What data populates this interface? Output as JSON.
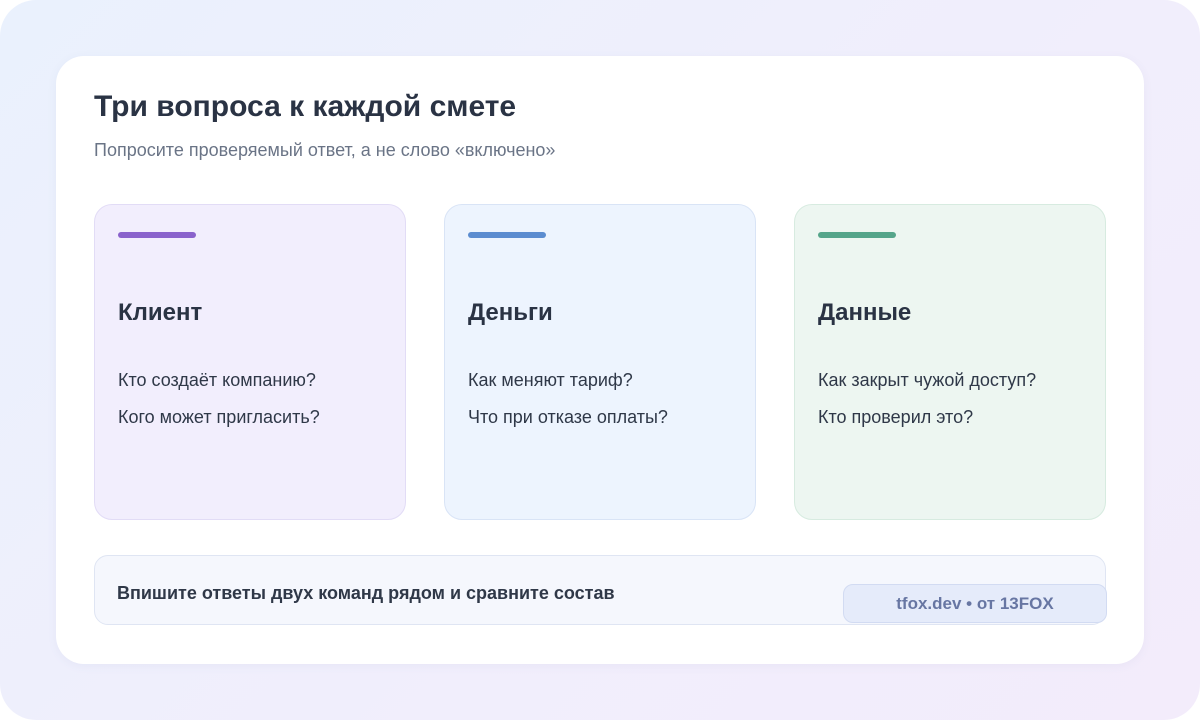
{
  "header": {
    "title": "Три вопроса к каждой смете",
    "subtitle": "Попросите проверяемый ответ, а не слово «включено»"
  },
  "topics": [
    {
      "title": "Клиент",
      "accent_color": "#8a62cc",
      "questions": [
        "Кто создаёт компанию?",
        "Кого может пригласить?"
      ]
    },
    {
      "title": "Деньги",
      "accent_color": "#5b8cd0",
      "questions": [
        "Как меняют тариф?",
        "Что при отказе оплаты?"
      ]
    },
    {
      "title": "Данные",
      "accent_color": "#55a58a",
      "questions": [
        "Как закрыт чужой доступ?",
        "Кто проверил это?"
      ]
    }
  ],
  "footer": {
    "text": "Впишите ответы двух команд рядом и сравните состав",
    "credit": "tfox.dev • от 13FOX"
  }
}
